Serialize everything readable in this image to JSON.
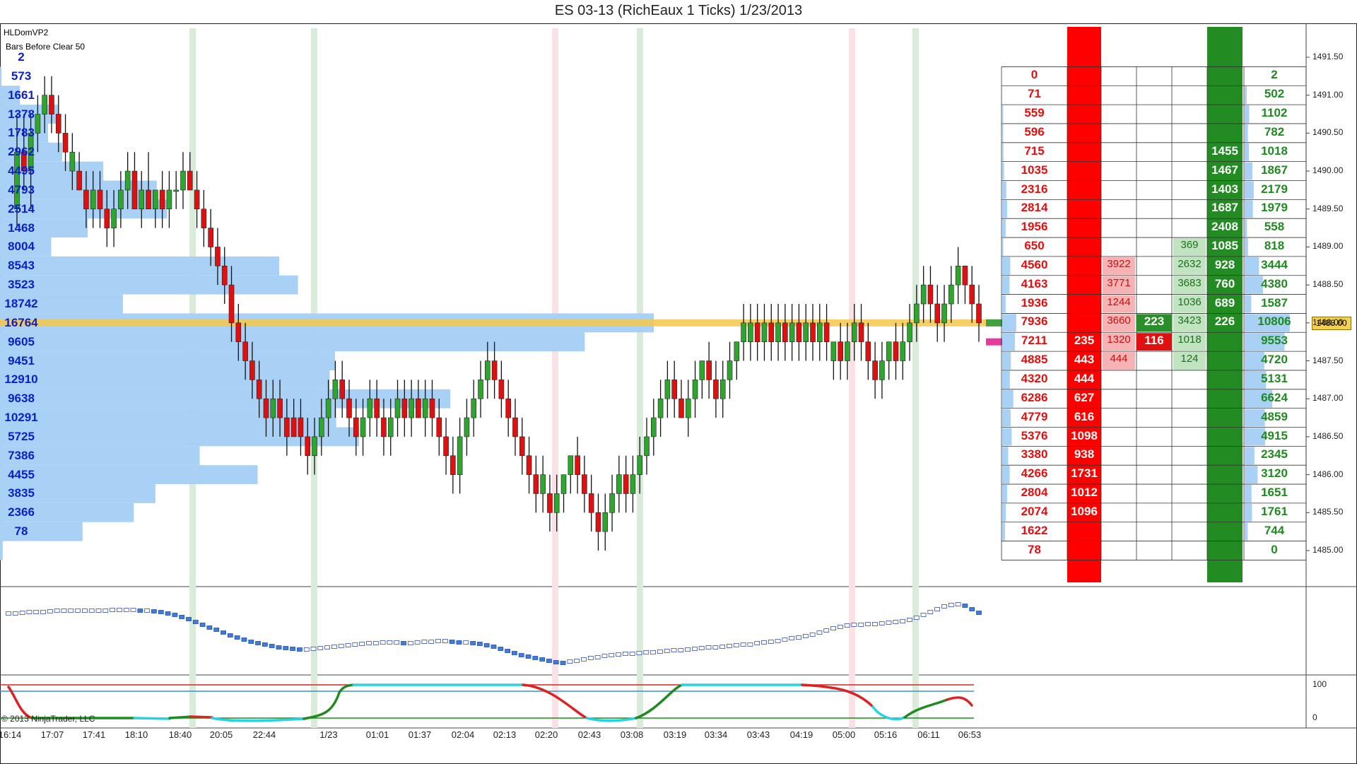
{
  "title": "ES 03-13 (RichEaux 1 Ticks)  1/23/2013",
  "indicator_name": "HLDomVP2",
  "bars_before_clear": "Bars Before Clear 50",
  "copyright": "© 2013 NinjaTrader, LLC",
  "last_price": "1488.00",
  "colors": {
    "up": "#2ea62e",
    "down": "#e01010",
    "profile": "#a9d0f5",
    "poc": "#f6c84a",
    "bid_col": "#ff0000",
    "ask_col": "#228b22"
  },
  "price_axis": [
    "1491.50",
    "1491.00",
    "1490.50",
    "1490.00",
    "1489.50",
    "1489.00",
    "1488.50",
    "1488.00",
    "1487.50",
    "1487.00",
    "1486.50",
    "1486.00",
    "1485.50",
    "1485.00"
  ],
  "osc_axis": [
    "100",
    "0"
  ],
  "time_axis": [
    "16:14",
    "17:07",
    "17:41",
    "18:10",
    "18:40",
    "20:05",
    "22:44",
    "1/23",
    "01:01",
    "01:37",
    "02:04",
    "02:13",
    "02:20",
    "02:43",
    "03:08",
    "03:19",
    "03:34",
    "03:43",
    "04:19",
    "05:00",
    "05:16",
    "06:11",
    "06:53"
  ],
  "volume_profile": [
    "2",
    "573",
    "1661",
    "1378",
    "1783",
    "2962",
    "4495",
    "4793",
    "2514",
    "1468",
    "8004",
    "8543",
    "3523",
    "18742",
    "16764",
    "9605",
    "9451",
    "12910",
    "9638",
    "10291",
    "5725",
    "7386",
    "4455",
    "3835",
    "2366",
    "78"
  ],
  "dom": {
    "bid_totals": [
      "0",
      "71",
      "559",
      "596",
      "715",
      "1035",
      "2316",
      "2814",
      "1956",
      "650",
      "4560",
      "4163",
      "1936",
      "7936",
      "7211",
      "4885",
      "4320",
      "6286",
      "4779",
      "5376",
      "3380",
      "4266",
      "2804",
      "2074",
      "1622",
      "78"
    ],
    "bid_column": {
      "row14": "235",
      "row15": "443",
      "row16": "444",
      "row17": "627",
      "row18": "616",
      "row19": "1098",
      "row20": "938",
      "row21": "1731",
      "row22": "1012",
      "row23": "1096"
    },
    "bid_pull": {
      "row10": "3922",
      "row11": "3771",
      "row12": "1244",
      "row13": "3660",
      "row14": "1320",
      "row15": "444"
    },
    "bid_center": {
      "row14": "116"
    },
    "ask_center": {
      "row13": "223"
    },
    "ask_pull": {
      "row9": "369",
      "row10": "2632",
      "row11": "3683",
      "row12": "1036",
      "row13": "3423",
      "row14": "1018",
      "row15": "124"
    },
    "ask_column": {
      "row4": "1455",
      "row5": "1467",
      "row6": "1403",
      "row7": "1687",
      "row8": "2408",
      "row9": "1085",
      "row10": "928",
      "row11": "760",
      "row12": "689",
      "row13": "226"
    },
    "ask_totals": [
      "2",
      "502",
      "1102",
      "782",
      "1018",
      "1867",
      "2179",
      "1979",
      "558",
      "818",
      "3444",
      "4380",
      "1587",
      "10806",
      "9553",
      "4720",
      "5131",
      "6624",
      "4859",
      "4915",
      "2345",
      "3120",
      "1651",
      "1761",
      "744",
      "0"
    ]
  },
  "chart_data": {
    "type": "candlestick",
    "title": "ES 03-13 (RichEaux 1 Ticks)  1/23/2013",
    "ylim": [
      1484.8,
      1491.7
    ],
    "tick_size": 0.25,
    "candles": [
      {
        "o": 1489.5,
        "h": 1490.75,
        "l": 1489.25,
        "c": 1490.25
      },
      {
        "o": 1490.25,
        "h": 1490.75,
        "l": 1489.75,
        "c": 1490.0
      },
      {
        "o": 1490.0,
        "h": 1490.75,
        "l": 1489.5,
        "c": 1490.5
      },
      {
        "o": 1490.5,
        "h": 1491.0,
        "l": 1490.25,
        "c": 1490.75
      },
      {
        "o": 1490.75,
        "h": 1491.25,
        "l": 1490.5,
        "c": 1491.0
      },
      {
        "o": 1491.0,
        "h": 1491.25,
        "l": 1490.5,
        "c": 1490.75
      },
      {
        "o": 1490.75,
        "h": 1491.0,
        "l": 1490.25,
        "c": 1490.5
      },
      {
        "o": 1490.5,
        "h": 1490.75,
        "l": 1490.0,
        "c": 1490.25
      },
      {
        "o": 1490.0,
        "h": 1490.5,
        "l": 1489.75,
        "c": 1490.25
      },
      {
        "o": 1490.0,
        "h": 1490.25,
        "l": 1489.75,
        "c": 1489.75
      },
      {
        "o": 1489.75,
        "h": 1490.0,
        "l": 1489.25,
        "c": 1489.5
      },
      {
        "o": 1489.5,
        "h": 1490.0,
        "l": 1489.25,
        "c": 1489.75
      },
      {
        "o": 1489.75,
        "h": 1490.0,
        "l": 1489.25,
        "c": 1489.5
      },
      {
        "o": 1489.5,
        "h": 1489.75,
        "l": 1489.0,
        "c": 1489.25
      },
      {
        "o": 1489.25,
        "h": 1489.75,
        "l": 1489.0,
        "c": 1489.5
      },
      {
        "o": 1489.5,
        "h": 1490.0,
        "l": 1489.25,
        "c": 1489.75
      },
      {
        "o": 1489.75,
        "h": 1490.25,
        "l": 1489.5,
        "c": 1490.0
      },
      {
        "o": 1490.0,
        "h": 1490.25,
        "l": 1489.5,
        "c": 1489.5
      },
      {
        "o": 1489.5,
        "h": 1490.0,
        "l": 1489.25,
        "c": 1489.75
      },
      {
        "o": 1489.75,
        "h": 1490.25,
        "l": 1489.5,
        "c": 1489.5
      },
      {
        "o": 1489.5,
        "h": 1489.75,
        "l": 1489.25,
        "c": 1489.75
      },
      {
        "o": 1489.75,
        "h": 1490.0,
        "l": 1489.25,
        "c": 1489.5
      },
      {
        "o": 1489.5,
        "h": 1490.0,
        "l": 1489.25,
        "c": 1489.75
      },
      {
        "o": 1489.75,
        "h": 1490.0,
        "l": 1489.5,
        "c": 1489.75
      },
      {
        "o": 1489.75,
        "h": 1490.25,
        "l": 1489.5,
        "c": 1490.0
      },
      {
        "o": 1490.0,
        "h": 1490.25,
        "l": 1489.75,
        "c": 1489.75
      },
      {
        "o": 1489.75,
        "h": 1490.0,
        "l": 1489.25,
        "c": 1489.5
      },
      {
        "o": 1489.5,
        "h": 1489.75,
        "l": 1489.0,
        "c": 1489.25
      },
      {
        "o": 1489.25,
        "h": 1489.5,
        "l": 1488.75,
        "c": 1489.0
      },
      {
        "o": 1489.0,
        "h": 1489.25,
        "l": 1488.5,
        "c": 1488.75
      },
      {
        "o": 1488.75,
        "h": 1489.0,
        "l": 1488.25,
        "c": 1488.5
      },
      {
        "o": 1488.5,
        "h": 1488.75,
        "l": 1487.75,
        "c": 1488.0
      },
      {
        "o": 1488.0,
        "h": 1488.25,
        "l": 1487.5,
        "c": 1487.75
      },
      {
        "o": 1487.75,
        "h": 1488.0,
        "l": 1487.25,
        "c": 1487.5
      },
      {
        "o": 1487.5,
        "h": 1487.75,
        "l": 1487.0,
        "c": 1487.25
      },
      {
        "o": 1487.25,
        "h": 1487.5,
        "l": 1486.75,
        "c": 1487.0
      },
      {
        "o": 1487.0,
        "h": 1487.25,
        "l": 1486.5,
        "c": 1486.75
      },
      {
        "o": 1486.75,
        "h": 1487.25,
        "l": 1486.5,
        "c": 1487.0
      },
      {
        "o": 1487.0,
        "h": 1487.25,
        "l": 1486.5,
        "c": 1486.75
      },
      {
        "o": 1486.75,
        "h": 1487.0,
        "l": 1486.25,
        "c": 1486.5
      },
      {
        "o": 1486.75,
        "h": 1487.0,
        "l": 1486.5,
        "c": 1486.5
      },
      {
        "o": 1486.75,
        "h": 1487.0,
        "l": 1486.25,
        "c": 1486.5
      },
      {
        "o": 1486.5,
        "h": 1486.75,
        "l": 1486.0,
        "c": 1486.25
      },
      {
        "o": 1486.25,
        "h": 1486.75,
        "l": 1486.0,
        "c": 1486.5
      },
      {
        "o": 1486.5,
        "h": 1487.0,
        "l": 1486.25,
        "c": 1486.75
      },
      {
        "o": 1486.75,
        "h": 1487.25,
        "l": 1486.5,
        "c": 1487.0
      },
      {
        "o": 1487.0,
        "h": 1487.5,
        "l": 1486.75,
        "c": 1487.25
      },
      {
        "o": 1487.25,
        "h": 1487.5,
        "l": 1486.75,
        "c": 1487.0
      },
      {
        "o": 1487.0,
        "h": 1487.25,
        "l": 1486.5,
        "c": 1486.75
      },
      {
        "o": 1486.75,
        "h": 1487.0,
        "l": 1486.25,
        "c": 1486.5
      },
      {
        "o": 1486.5,
        "h": 1487.0,
        "l": 1486.25,
        "c": 1486.75
      },
      {
        "o": 1486.75,
        "h": 1487.25,
        "l": 1486.5,
        "c": 1487.0
      },
      {
        "o": 1487.0,
        "h": 1487.25,
        "l": 1486.5,
        "c": 1486.75
      },
      {
        "o": 1486.75,
        "h": 1487.0,
        "l": 1486.25,
        "c": 1486.5
      },
      {
        "o": 1486.5,
        "h": 1487.0,
        "l": 1486.25,
        "c": 1486.75
      },
      {
        "o": 1486.75,
        "h": 1487.25,
        "l": 1486.5,
        "c": 1487.0
      },
      {
        "o": 1487.0,
        "h": 1487.25,
        "l": 1486.5,
        "c": 1486.75
      },
      {
        "o": 1486.75,
        "h": 1487.25,
        "l": 1486.5,
        "c": 1487.0
      },
      {
        "o": 1487.0,
        "h": 1487.25,
        "l": 1486.75,
        "c": 1486.75
      },
      {
        "o": 1486.75,
        "h": 1487.25,
        "l": 1486.5,
        "c": 1487.0
      },
      {
        "o": 1487.0,
        "h": 1487.25,
        "l": 1486.5,
        "c": 1486.75
      },
      {
        "o": 1486.75,
        "h": 1487.0,
        "l": 1486.25,
        "c": 1486.5
      },
      {
        "o": 1486.5,
        "h": 1486.75,
        "l": 1486.0,
        "c": 1486.25
      },
      {
        "o": 1486.25,
        "h": 1486.5,
        "l": 1485.75,
        "c": 1486.0
      },
      {
        "o": 1486.0,
        "h": 1486.75,
        "l": 1485.75,
        "c": 1486.5
      },
      {
        "o": 1486.5,
        "h": 1487.0,
        "l": 1486.25,
        "c": 1486.75
      },
      {
        "o": 1486.75,
        "h": 1487.25,
        "l": 1486.5,
        "c": 1487.0
      },
      {
        "o": 1487.0,
        "h": 1487.5,
        "l": 1486.75,
        "c": 1487.25
      },
      {
        "o": 1487.25,
        "h": 1487.75,
        "l": 1487.0,
        "c": 1487.5
      },
      {
        "o": 1487.5,
        "h": 1487.75,
        "l": 1487.0,
        "c": 1487.25
      },
      {
        "o": 1487.25,
        "h": 1487.5,
        "l": 1486.75,
        "c": 1487.0
      },
      {
        "o": 1487.0,
        "h": 1487.25,
        "l": 1486.5,
        "c": 1486.75
      },
      {
        "o": 1486.75,
        "h": 1487.0,
        "l": 1486.25,
        "c": 1486.5
      },
      {
        "o": 1486.5,
        "h": 1486.75,
        "l": 1486.0,
        "c": 1486.25
      },
      {
        "o": 1486.25,
        "h": 1486.5,
        "l": 1485.75,
        "c": 1486.0
      },
      {
        "o": 1486.0,
        "h": 1486.25,
        "l": 1485.5,
        "c": 1485.75
      },
      {
        "o": 1485.75,
        "h": 1486.25,
        "l": 1485.5,
        "c": 1486.0
      },
      {
        "o": 1485.75,
        "h": 1486.0,
        "l": 1485.25,
        "c": 1485.5
      },
      {
        "o": 1485.5,
        "h": 1486.0,
        "l": 1485.25,
        "c": 1485.75
      },
      {
        "o": 1485.75,
        "h": 1486.0,
        "l": 1485.5,
        "c": 1486.0
      },
      {
        "o": 1486.0,
        "h": 1486.25,
        "l": 1485.75,
        "c": 1486.25
      },
      {
        "o": 1486.25,
        "h": 1486.5,
        "l": 1485.75,
        "c": 1486.0
      },
      {
        "o": 1486.0,
        "h": 1486.25,
        "l": 1485.5,
        "c": 1485.75
      },
      {
        "o": 1485.75,
        "h": 1486.0,
        "l": 1485.25,
        "c": 1485.5
      },
      {
        "o": 1485.5,
        "h": 1485.75,
        "l": 1485.0,
        "c": 1485.25
      },
      {
        "o": 1485.25,
        "h": 1485.75,
        "l": 1485.0,
        "c": 1485.5
      },
      {
        "o": 1485.5,
        "h": 1486.0,
        "l": 1485.25,
        "c": 1485.75
      },
      {
        "o": 1485.75,
        "h": 1486.25,
        "l": 1485.5,
        "c": 1486.0
      },
      {
        "o": 1486.0,
        "h": 1486.25,
        "l": 1485.5,
        "c": 1485.75
      },
      {
        "o": 1485.75,
        "h": 1486.25,
        "l": 1485.5,
        "c": 1486.0
      },
      {
        "o": 1486.0,
        "h": 1486.5,
        "l": 1485.75,
        "c": 1486.25
      },
      {
        "o": 1486.25,
        "h": 1486.75,
        "l": 1486.0,
        "c": 1486.5
      },
      {
        "o": 1486.5,
        "h": 1487.0,
        "l": 1486.25,
        "c": 1486.75
      },
      {
        "o": 1486.75,
        "h": 1487.25,
        "l": 1486.5,
        "c": 1487.0
      },
      {
        "o": 1487.0,
        "h": 1487.5,
        "l": 1486.75,
        "c": 1487.25
      },
      {
        "o": 1487.25,
        "h": 1487.5,
        "l": 1486.75,
        "c": 1487.0
      },
      {
        "o": 1487.0,
        "h": 1487.25,
        "l": 1486.75,
        "c": 1486.75
      },
      {
        "o": 1486.75,
        "h": 1487.25,
        "l": 1486.5,
        "c": 1487.0
      },
      {
        "o": 1487.0,
        "h": 1487.5,
        "l": 1486.75,
        "c": 1487.25
      },
      {
        "o": 1487.25,
        "h": 1487.5,
        "l": 1487.0,
        "c": 1487.5
      },
      {
        "o": 1487.5,
        "h": 1487.75,
        "l": 1487.0,
        "c": 1487.25
      },
      {
        "o": 1487.25,
        "h": 1487.5,
        "l": 1486.75,
        "c": 1487.0
      },
      {
        "o": 1487.0,
        "h": 1487.5,
        "l": 1486.75,
        "c": 1487.25
      },
      {
        "o": 1487.25,
        "h": 1487.75,
        "l": 1487.0,
        "c": 1487.5
      },
      {
        "o": 1487.5,
        "h": 1487.75,
        "l": 1487.25,
        "c": 1487.75
      },
      {
        "o": 1487.75,
        "h": 1488.25,
        "l": 1487.5,
        "c": 1488.0
      },
      {
        "o": 1487.75,
        "h": 1488.25,
        "l": 1487.5,
        "c": 1488.0
      },
      {
        "o": 1488.0,
        "h": 1488.25,
        "l": 1487.5,
        "c": 1487.75
      },
      {
        "o": 1487.75,
        "h": 1488.25,
        "l": 1487.5,
        "c": 1488.0
      },
      {
        "o": 1488.0,
        "h": 1488.25,
        "l": 1487.5,
        "c": 1487.75
      },
      {
        "o": 1487.75,
        "h": 1488.25,
        "l": 1487.5,
        "c": 1488.0
      },
      {
        "o": 1488.0,
        "h": 1488.25,
        "l": 1487.5,
        "c": 1487.75
      },
      {
        "o": 1487.75,
        "h": 1488.25,
        "l": 1487.5,
        "c": 1488.0
      },
      {
        "o": 1488.0,
        "h": 1488.25,
        "l": 1487.5,
        "c": 1487.75
      },
      {
        "o": 1487.75,
        "h": 1488.25,
        "l": 1487.5,
        "c": 1488.0
      },
      {
        "o": 1488.0,
        "h": 1488.25,
        "l": 1487.5,
        "c": 1487.75
      },
      {
        "o": 1487.75,
        "h": 1488.25,
        "l": 1487.5,
        "c": 1488.0
      },
      {
        "o": 1488.0,
        "h": 1488.25,
        "l": 1487.5,
        "c": 1487.75
      },
      {
        "o": 1487.5,
        "h": 1487.75,
        "l": 1487.25,
        "c": 1487.75
      },
      {
        "o": 1487.75,
        "h": 1488.0,
        "l": 1487.25,
        "c": 1487.5
      },
      {
        "o": 1487.5,
        "h": 1488.0,
        "l": 1487.25,
        "c": 1487.75
      },
      {
        "o": 1487.75,
        "h": 1488.25,
        "l": 1487.5,
        "c": 1488.0
      },
      {
        "o": 1488.0,
        "h": 1488.25,
        "l": 1487.5,
        "c": 1487.75
      },
      {
        "o": 1487.75,
        "h": 1488.0,
        "l": 1487.25,
        "c": 1487.5
      },
      {
        "o": 1487.5,
        "h": 1487.75,
        "l": 1487.0,
        "c": 1487.25
      },
      {
        "o": 1487.25,
        "h": 1487.75,
        "l": 1487.0,
        "c": 1487.5
      },
      {
        "o": 1487.5,
        "h": 1487.75,
        "l": 1487.25,
        "c": 1487.75
      },
      {
        "o": 1487.75,
        "h": 1488.0,
        "l": 1487.25,
        "c": 1487.5
      },
      {
        "o": 1487.5,
        "h": 1488.0,
        "l": 1487.25,
        "c": 1487.75
      },
      {
        "o": 1487.75,
        "h": 1488.25,
        "l": 1487.5,
        "c": 1488.0
      },
      {
        "o": 1488.0,
        "h": 1488.5,
        "l": 1487.75,
        "c": 1488.25
      },
      {
        "o": 1488.25,
        "h": 1488.75,
        "l": 1488.0,
        "c": 1488.5
      },
      {
        "o": 1488.5,
        "h": 1488.75,
        "l": 1488.0,
        "c": 1488.25
      },
      {
        "o": 1488.25,
        "h": 1488.5,
        "l": 1487.75,
        "c": 1488.0
      },
      {
        "o": 1488.0,
        "h": 1488.5,
        "l": 1487.75,
        "c": 1488.25
      },
      {
        "o": 1488.25,
        "h": 1488.75,
        "l": 1488.0,
        "c": 1488.5
      },
      {
        "o": 1488.5,
        "h": 1489.0,
        "l": 1488.25,
        "c": 1488.75
      },
      {
        "o": 1488.75,
        "h": 1488.75,
        "l": 1488.25,
        "c": 1488.5
      },
      {
        "o": 1488.5,
        "h": 1488.75,
        "l": 1488.0,
        "c": 1488.25
      },
      {
        "o": 1488.25,
        "h": 1488.5,
        "l": 1487.75,
        "c": 1488.0
      }
    ],
    "volume_profile_rows": [
      2,
      573,
      1661,
      1378,
      1783,
      2962,
      4495,
      4793,
      2514,
      1468,
      8004,
      8543,
      3523,
      18742,
      16764,
      9605,
      9451,
      12910,
      9638,
      10291,
      5725,
      7386,
      4455,
      3835,
      2366,
      78
    ],
    "oscillator": {
      "ylim": [
        0,
        100
      ],
      "upper_level": 100,
      "lower_level": 0,
      "mid_level": 80
    },
    "session_markers_green": [
      "18:40",
      "22:44",
      "03:08",
      "06:11"
    ],
    "session_markers_red": [
      "02:20",
      "05:00"
    ]
  }
}
